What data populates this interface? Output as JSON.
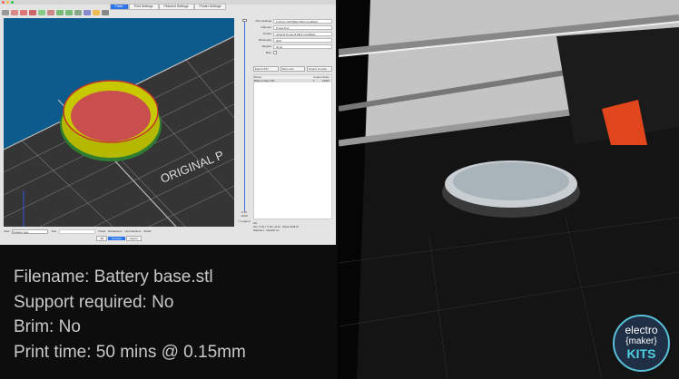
{
  "slicer": {
    "tabs": [
      "Plater",
      "Print Settings",
      "Filament Settings",
      "Printer Settings"
    ],
    "sidebar": {
      "rows": [
        {
          "label": "Print settings",
          "value": "0.15mm OPTIMAL MK3 (modified)"
        },
        {
          "label": "Filament",
          "value": "Prusa PLA"
        },
        {
          "label": "Printer",
          "value": "Original Prusa i3 MK3 (modified)"
        },
        {
          "label": "Fill density",
          "value": "20%"
        },
        {
          "label": "Support",
          "value": "None"
        },
        {
          "label": "Brim",
          "value": ""
        }
      ],
      "buttons": [
        "Export STL...",
        "Slice now",
        "Export G-code..."
      ],
      "list_headers": [
        "Name",
        "Copies",
        "Scale"
      ],
      "list_rows": [
        {
          "name": "Battery base.STL",
          "copies": "1",
          "scale": "100%"
        }
      ],
      "info_title": "Info",
      "info": [
        {
          "label": "Size",
          "value": "77.00 x 77.00 x 10.00"
        },
        {
          "label": "Volume",
          "value": "9415.39"
        },
        {
          "label": "Materials",
          "value": "1"
        },
        {
          "label": "Manifold",
          "value": "Yes"
        }
      ]
    },
    "bed_text": "ORIGINAL P",
    "slider_top": "10.00",
    "slider_bottom": "0.15",
    "legend_label": "Legend",
    "bottom": {
      "view_label": "View",
      "view_value": "Feature type",
      "tool_label": "Tool",
      "tool_value": "",
      "checks": [
        "Travel",
        "Retractions",
        "Unretractions",
        "Shells"
      ],
      "view_tabs": [
        "3D",
        "Preview",
        "Layers"
      ]
    }
  },
  "caption": {
    "lines": [
      "Filename: Battery base.stl",
      "Support required: No",
      "Brim: No",
      "Print time: 50 mins @ 0.15mm"
    ]
  },
  "logo": {
    "line1": "electro",
    "line2": "{maker}",
    "line3": "KITS"
  }
}
